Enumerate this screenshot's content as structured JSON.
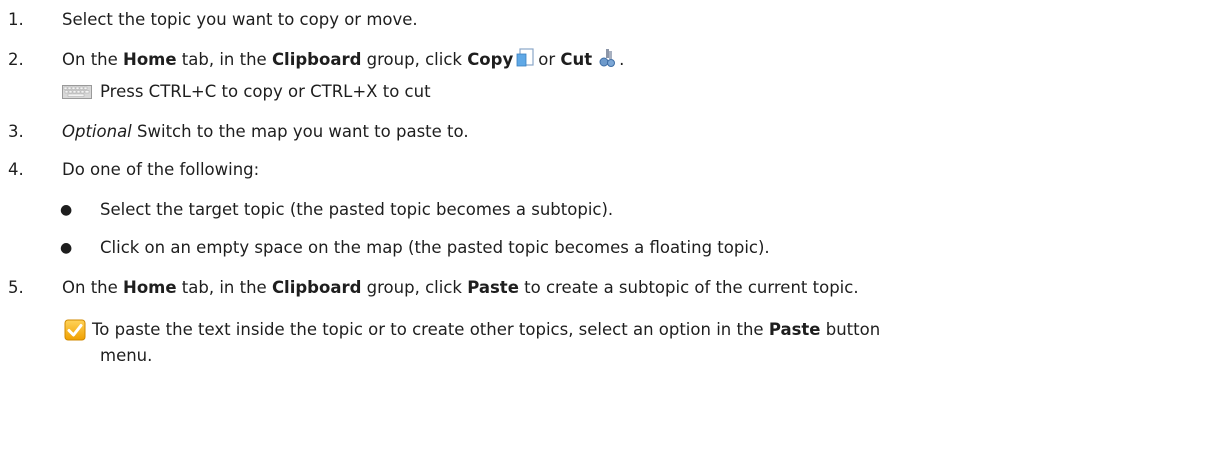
{
  "steps": {
    "s1": {
      "num": "1.",
      "text": "Select the topic you want to copy or move."
    },
    "s2": {
      "num": "2.",
      "t1": "On the ",
      "home": "Home",
      "t2": " tab, in the ",
      "clipboard": "Clipboard",
      "t3": " group, click ",
      "copy": "Copy",
      "or": "or ",
      "cut": "Cut",
      "end": ".",
      "shortcut": "Press CTRL+C to copy or CTRL+X to cut"
    },
    "s3": {
      "num": "3.",
      "optional": "Optional",
      "text": " Switch to the map you want to paste to."
    },
    "s4": {
      "num": "4.",
      "text": "Do one of the following:",
      "bullets": [
        "Select the target topic (the pasted topic becomes a subtopic).",
        "Click on an empty space on the map (the pasted topic becomes a floating topic)."
      ]
    },
    "s5": {
      "num": "5.",
      "t1": "On the ",
      "home": "Home",
      "t2": " tab, in the ",
      "clipboard": "Clipboard",
      "t3": " group, click ",
      "paste": "Paste",
      "t4": " to create a subtopic of the current topic.",
      "tip1": " To paste the text inside the topic or to create other topics, select an option in the ",
      "tip_paste": "Paste",
      "tip2": " button",
      "tip3": "menu."
    }
  },
  "icons": {
    "copy": "copy-icon",
    "cut": "cut-icon",
    "keyboard": "keyboard-icon",
    "tip": "checkmark-tip-icon"
  }
}
